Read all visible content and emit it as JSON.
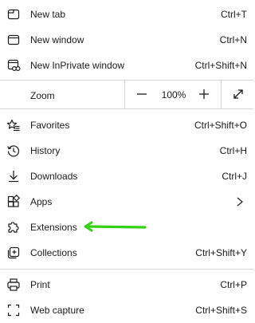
{
  "menu": {
    "new_tab": {
      "label": "New tab",
      "shortcut": "Ctrl+T",
      "icon": "new-tab-icon"
    },
    "new_window": {
      "label": "New window",
      "shortcut": "Ctrl+N",
      "icon": "new-window-icon"
    },
    "new_inprivate": {
      "label": "New InPrivate window",
      "shortcut": "Ctrl+Shift+N",
      "icon": "inprivate-icon"
    },
    "zoom": {
      "label": "Zoom",
      "value": "100%",
      "decrease_icon": "minus-icon",
      "increase_icon": "plus-icon",
      "fullscreen_icon": "fullscreen-icon"
    },
    "favorites": {
      "label": "Favorites",
      "shortcut": "Ctrl+Shift+O",
      "icon": "favorites-icon"
    },
    "history": {
      "label": "History",
      "shortcut": "Ctrl+H",
      "icon": "history-icon"
    },
    "downloads": {
      "label": "Downloads",
      "shortcut": "Ctrl+J",
      "icon": "download-icon"
    },
    "apps": {
      "label": "Apps",
      "icon": "apps-icon",
      "submenu_icon": "chevron-right-icon"
    },
    "extensions": {
      "label": "Extensions",
      "icon": "extensions-icon"
    },
    "collections": {
      "label": "Collections",
      "shortcut": "Ctrl+Shift+Y",
      "icon": "collections-icon"
    },
    "print": {
      "label": "Print",
      "shortcut": "Ctrl+P",
      "icon": "print-icon"
    },
    "web_capture": {
      "label": "Web capture",
      "shortcut": "Ctrl+Shift+S",
      "icon": "web-capture-icon"
    }
  },
  "annotation": {
    "color": "#35d016",
    "icon": "arrow-left-icon"
  }
}
